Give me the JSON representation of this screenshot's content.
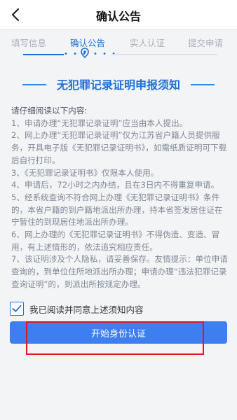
{
  "header": {
    "title": "确认公告",
    "back_icon": "chevron-left-icon"
  },
  "steps": [
    {
      "label": "填写信息",
      "active": false
    },
    {
      "label": "确认公告",
      "active": true
    },
    {
      "label": "实人认证",
      "active": false
    },
    {
      "label": "提交申请",
      "active": false
    }
  ],
  "notice": {
    "title": "无犯罪记录证明申报须知",
    "intro": "请仔细阅读以下内容:",
    "items": [
      "1、申请办理“无犯罪记录证明”应当由本人提出。",
      "2、网上办理“无犯罪记录证明”仅为江苏省户籍人员提供服务，开具电子版《无犯罪记录证明书》，如需纸质证明可下载后自行打印。",
      "3、《无犯罪记录证明书》仅限本人使用。",
      "4、申请后，72小时之内办结，且在3日内不得重复申请。",
      "5、经系统查询不符合网上办理《无犯罪记录证明书》条件的，本省户籍的到户籍地派出所办理，持本省签发居住证在宁暂住的到现居住地派出所办理。",
      "6、网上办理的《无犯罪记录证明书》不得伪造、变造、冒用，有上述情形的，依法追究相应责任。",
      "7、该证明涉及个人隐私，请妥善保存。友情提示：单位申请查询的，到单位住所地派出所办理；申请办理“违法犯罪记录查询证明”的，到派出所按规定办理。"
    ]
  },
  "agree": {
    "checked": true,
    "label": "我已阅读并同意上述须知内容"
  },
  "start_button": {
    "label": "开始身份认证"
  },
  "colors": {
    "accent": "#1f6fd9",
    "button": "#3d7ef1",
    "highlight": "#e3141b"
  }
}
